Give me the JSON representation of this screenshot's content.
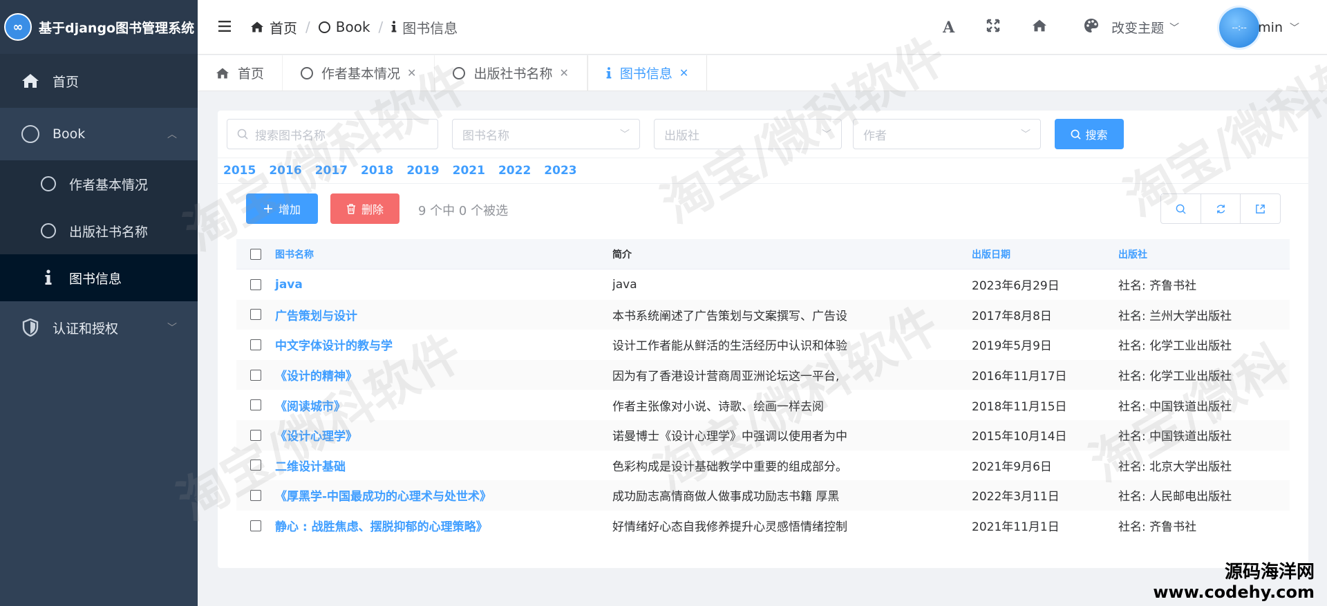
{
  "app": {
    "title": "基于django图书管理系统",
    "logo_glyph": "∞"
  },
  "sidebar": {
    "home_label": "首页",
    "book_group_label": "Book",
    "book_items": [
      {
        "label": "作者基本情况"
      },
      {
        "label": "出版社书名称"
      },
      {
        "label": "图书信息"
      }
    ],
    "auth_group_label": "认证和授权"
  },
  "header": {
    "breadcrumb": [
      "首页",
      "Book",
      "图书信息"
    ],
    "font_icon": "A",
    "theme_label": "改变主题",
    "avatar_text": "--:--",
    "username": "min"
  },
  "tabs": [
    {
      "label": "首页"
    },
    {
      "label": "作者基本情况"
    },
    {
      "label": "出版社书名称"
    },
    {
      "label": "图书信息"
    }
  ],
  "filters": {
    "search_placeholder": "搜索图书名称",
    "book_name_placeholder": "图书名称",
    "publisher_placeholder": "出版社",
    "author_placeholder": "作者",
    "search_button": "搜索"
  },
  "years": [
    "2015",
    "2016",
    "2017",
    "2018",
    "2019",
    "2021",
    "2022",
    "2023"
  ],
  "actions": {
    "add_label": "增加",
    "delete_label": "删除",
    "selection_info": "9 个中 0 个被选"
  },
  "table": {
    "headers": {
      "name": "图书名称",
      "desc": "简介",
      "date": "出版日期",
      "publisher": "出版社"
    },
    "rows": [
      {
        "name": "java",
        "desc": "java",
        "date": "2023年6月29日",
        "publisher": "社名: 齐鲁书社"
      },
      {
        "name": "广告策划与设计",
        "desc": "本书系统阐述了广告策划与文案撰写、广告设",
        "date": "2017年8月8日",
        "publisher": "社名: 兰州大学出版社"
      },
      {
        "name": "中文字体设计的教与学",
        "desc": "设计工作者能从鲜活的生活经历中认识和体验",
        "date": "2019年5月9日",
        "publisher": "社名: 化学工业出版社"
      },
      {
        "name": "《设计的精神》",
        "desc": "因为有了香港设计营商周亚洲论坛这一平台,",
        "date": "2016年11月17日",
        "publisher": "社名: 化学工业出版社"
      },
      {
        "name": "《阅读城市》",
        "desc": "作者主张像对小说、诗歌、绘画一样去阅",
        "date": "2018年11月15日",
        "publisher": "社名: 中国铁道出版社"
      },
      {
        "name": "《设计心理学》",
        "desc": "诺曼博士《设计心理学》中强调以使用者为中",
        "date": "2015年10月14日",
        "publisher": "社名: 中国铁道出版社"
      },
      {
        "name": "二维设计基础",
        "desc": "色彩构成是设计基础教学中重要的组成部分。",
        "date": "2021年9月6日",
        "publisher": "社名: 北京大学出版社"
      },
      {
        "name": "《厚黑学-中国最成功的心理术与处世术》",
        "desc": "成功励志高情商做人做事成功励志书籍 厚黑",
        "date": "2022年3月11日",
        "publisher": "社名: 人民邮电出版社"
      },
      {
        "name": "静心 : 战胜焦虑、摆脱抑郁的心理策略》",
        "desc": "好情绪好心态自我修养提升心灵感悟情绪控制",
        "date": "2021年11月1日",
        "publisher": "社名: 齐鲁书社"
      }
    ]
  },
  "watermark": {
    "text": "淘宝/微科软件"
  },
  "corner_watermark": {
    "line1": "源码海洋网",
    "line2": "www.codehy.com"
  },
  "colors": {
    "sidebar_bg": "#304156",
    "accent": "#409eff",
    "danger": "#f56c6c"
  }
}
